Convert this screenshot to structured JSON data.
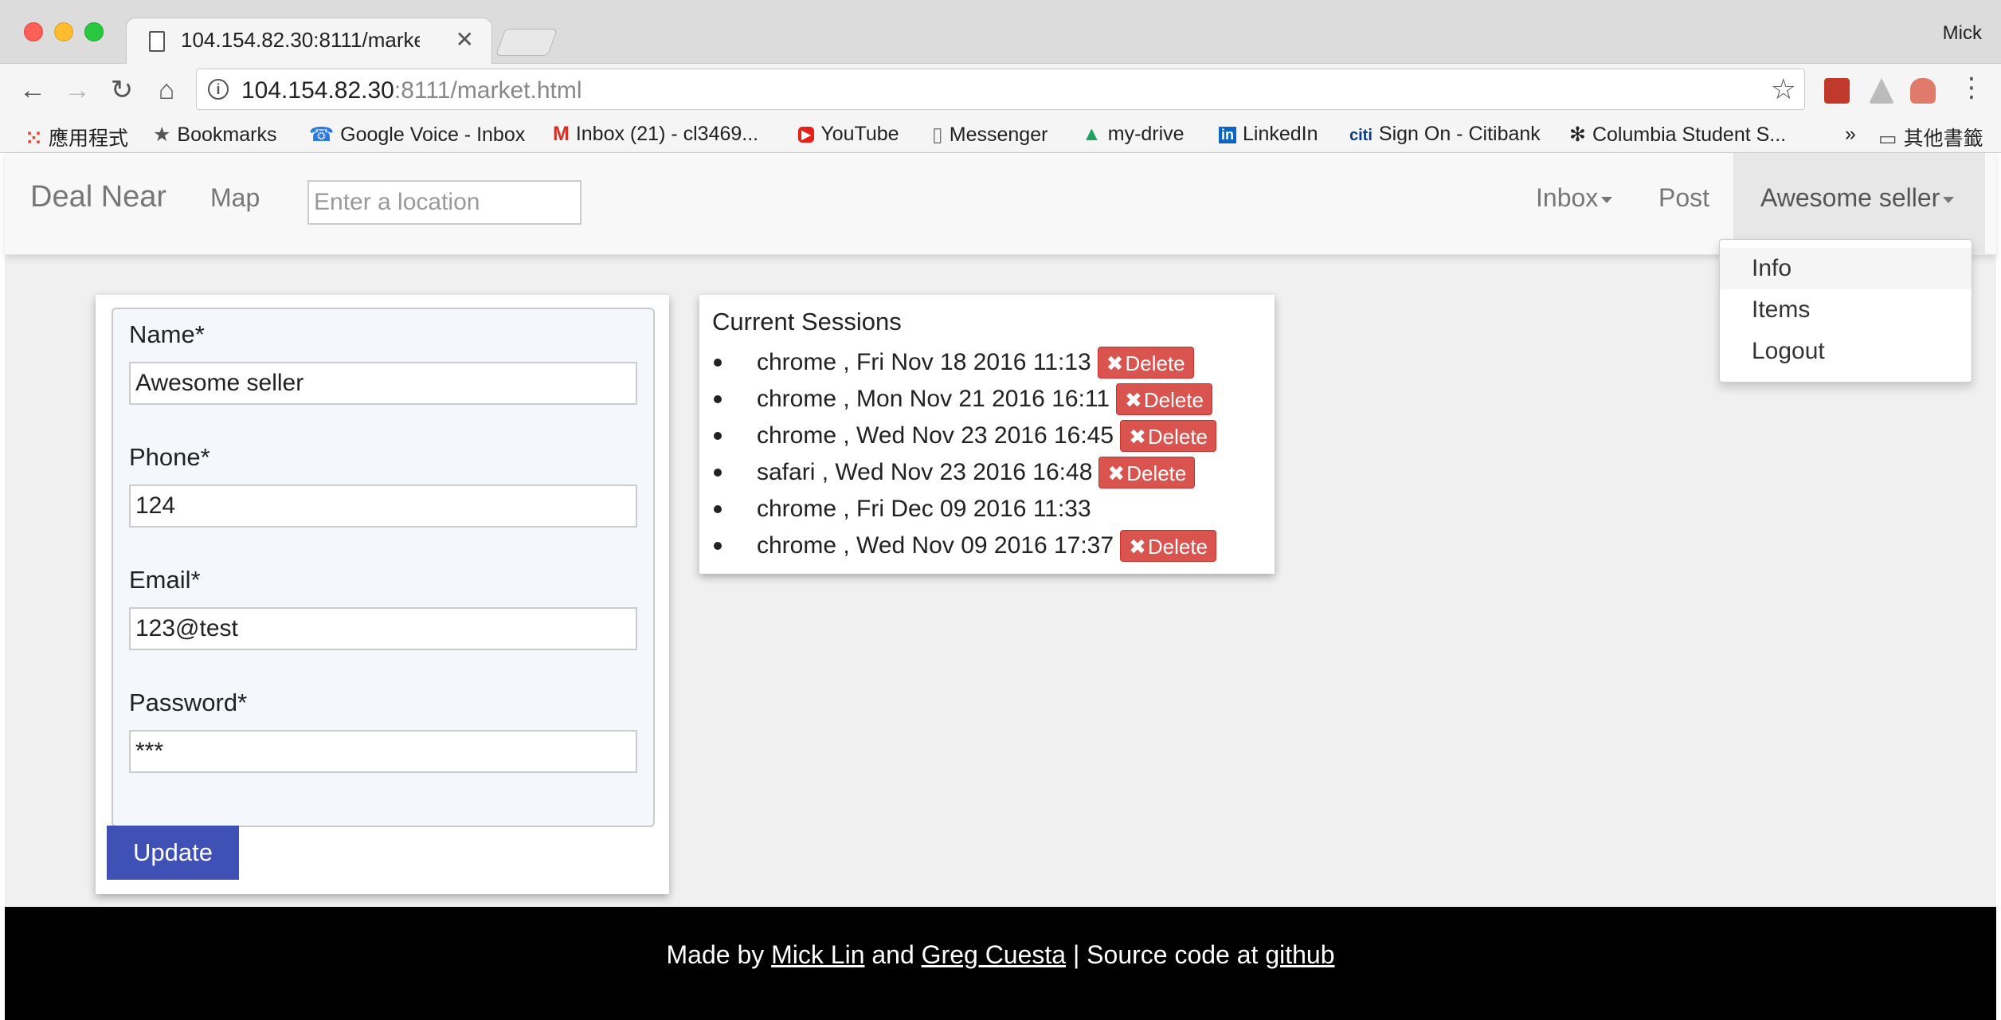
{
  "browser": {
    "tab_title": "104.154.82.30:8111/market.html",
    "profile_name": "Mick",
    "url_host": "104.154.82.30",
    "url_port": ":8111",
    "url_path": "/market.html",
    "bookmarks": [
      {
        "label": "應用程式",
        "icon": "apps-icon"
      },
      {
        "label": "Bookmarks",
        "icon": "star-icon"
      },
      {
        "label": "Google Voice - Inbox",
        "icon": "phone-icon"
      },
      {
        "label": "Inbox (21) - cl3469...",
        "icon": "gmail-icon"
      },
      {
        "label": "YouTube",
        "icon": "youtube-icon"
      },
      {
        "label": "Messenger",
        "icon": "page-icon"
      },
      {
        "label": "my-drive",
        "icon": "drive-icon"
      },
      {
        "label": "LinkedIn",
        "icon": "linkedin-icon"
      },
      {
        "label": "Sign On - Citibank",
        "icon": "citi-icon"
      },
      {
        "label": "Columbia Student S...",
        "icon": "flower-icon"
      }
    ],
    "other_bookmarks": "其他書籤",
    "overflow": "»"
  },
  "navbar": {
    "brand": "Deal Near",
    "map": "Map",
    "location_placeholder": "Enter a location",
    "inbox": "Inbox",
    "post": "Post",
    "user": "Awesome seller"
  },
  "dropdown": {
    "items": [
      "Info",
      "Items",
      "Logout"
    ]
  },
  "profile": {
    "name_label": "Name*",
    "name_value": "Awesome seller",
    "phone_label": "Phone*",
    "phone_value": "124",
    "email_label": "Email*",
    "email_value": "123@test",
    "password_label": "Password*",
    "password_value": "***",
    "update_label": "Update"
  },
  "sessions": {
    "title": "Current Sessions",
    "delete_label": "Delete",
    "rows": [
      {
        "text": "chrome , Fri Nov 18 2016 11:13",
        "deletable": true
      },
      {
        "text": "chrome , Mon Nov 21 2016 16:11",
        "deletable": true
      },
      {
        "text": "chrome , Wed Nov 23 2016 16:45",
        "deletable": true
      },
      {
        "text": "safari , Wed Nov 23 2016 16:48",
        "deletable": true
      },
      {
        "text": "chrome , Fri Dec 09 2016 11:33",
        "deletable": false
      },
      {
        "text": "chrome , Wed Nov 09 2016 17:37",
        "deletable": true
      }
    ]
  },
  "footer": {
    "made_by": "Made by",
    "author1": "Mick Lin",
    "and": "and",
    "author2": "Greg Cuesta",
    "source": "| Source code at",
    "github": "github"
  }
}
